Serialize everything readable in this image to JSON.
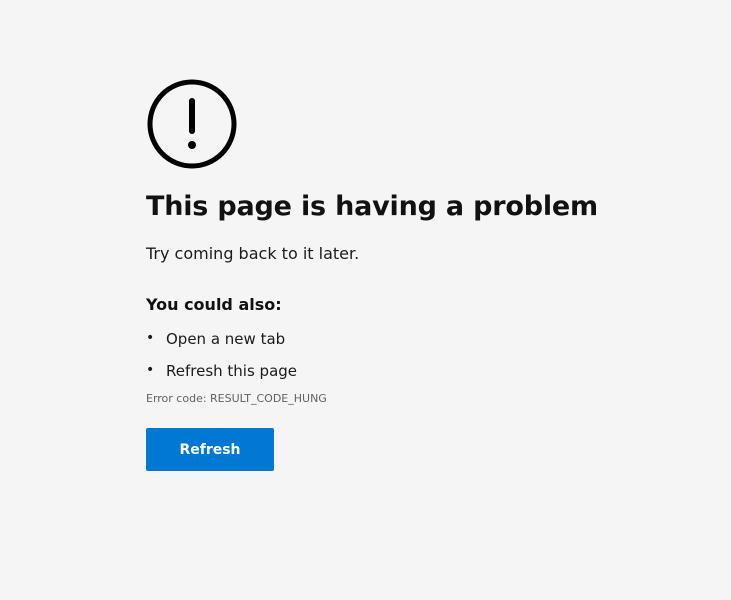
{
  "error_page": {
    "icon": "exclamation-circle-icon",
    "title": "This page is having a problem",
    "message": "Try coming back to it later.",
    "suggestions_heading": "You could also:",
    "suggestions": [
      {
        "bullet": "•",
        "label": "Open a new tab"
      },
      {
        "bullet": "•",
        "label": "Refresh this page"
      }
    ],
    "error_code": "Error code: RESULT_CODE_HUNG",
    "refresh_button_label": "Refresh"
  },
  "colors": {
    "background": "#f5f5f5",
    "accent": "#0078d4",
    "text": "#111111",
    "muted_text": "#616161"
  }
}
